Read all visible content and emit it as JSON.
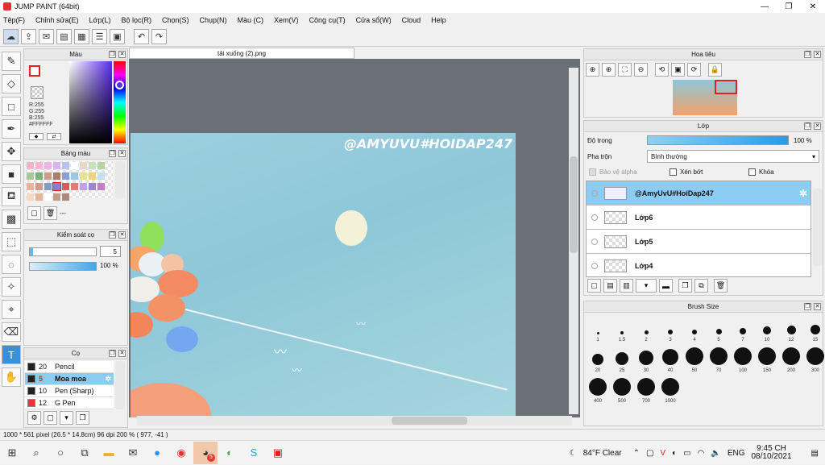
{
  "window": {
    "title": "JUMP PAINT (64bit)",
    "min": "—",
    "max": "❐",
    "close": "✕"
  },
  "menu": [
    "Tệp(F)",
    "Chỉnh sửa(E)",
    "Lớp(L)",
    "Bộ lọc(R)",
    "Chọn(S)",
    "Chụp(N)",
    "Màu (C)",
    "Xem(V)",
    "Công cụ(T)",
    "Cửa sổ(W)",
    "Cloud",
    "Help"
  ],
  "toolbar": {
    "icons": [
      "cloud-save-icon",
      "share-icon",
      "comment-icon",
      "message-icon",
      "document-icon",
      "list-icon",
      "grid-icon",
      "undo-icon",
      "redo-icon"
    ]
  },
  "tools": [
    "brush-icon",
    "eraser-icon",
    "rectangle-icon",
    "pen-icon",
    "move-icon",
    "fill-rect-icon",
    "bucket-icon",
    "gradient-icon",
    "select-rect-icon",
    "lasso-icon",
    "magic-wand-icon",
    "picker-icon",
    "select-eraser-icon",
    "text-icon",
    "hand-icon"
  ],
  "color_panel": {
    "title": "Màu",
    "r": "R:255",
    "g": "G:255",
    "b": "B:255",
    "hex": "#FFFFFF"
  },
  "palette_panel": {
    "title": "Bảng màu",
    "more": "---",
    "swatches": [
      "#f7b2c9",
      "#f6b7d6",
      "#f3b0e6",
      "#d7b3f0",
      "#b7c1f1",
      "#ffffff",
      "#e8d8c4",
      "#c6e2b7",
      "#b4d3a6",
      "#a9c99c",
      "#7ab07a",
      "#c79f86",
      "#a77f6c",
      "#8aa1d8",
      "#9bc9e2",
      "#e7e28f",
      "#f0d27e",
      "#c3e0ef",
      "#edb1a1",
      "#d39b8f",
      "#7f9ec6",
      "#8c7ed1",
      "#d35b5b",
      "#e67a7a",
      "#bfa4e3",
      "#9c83d9",
      "#c27fc7",
      "#f6d9c6",
      "#e5b59b",
      "#ffffff",
      "#c29b8a",
      "#a98a7c"
    ]
  },
  "brush_control": {
    "title": "Kiểm soát cọ",
    "size": "5",
    "opacity": "100 %"
  },
  "brushes": {
    "title": "Cọ",
    "items": [
      {
        "size": "20",
        "name": "Pencil",
        "color": "#222"
      },
      {
        "size": "5",
        "name": "Moa moa",
        "color": "#222"
      },
      {
        "size": "10",
        "name": "Pen (Sharp)",
        "color": "#222"
      },
      {
        "size": "12",
        "name": "G Pen",
        "color": "#e33"
      }
    ]
  },
  "document": {
    "tab": "tải xuống (2).png",
    "watermark": "@AMYUVU#HOIDAP247"
  },
  "navigator": {
    "title": "Hoa tiêu"
  },
  "layers": {
    "title": "Lớp",
    "opacity_label": "Độ trong",
    "opacity_value": "100 %",
    "blend_label": "Pha trộn",
    "blend_value": "Bình thường",
    "protect_alpha": "Bảo vệ alpha",
    "clip": "Xén bớt",
    "lock": "Khóa",
    "items": [
      "@AmyUvU#HoiDap247",
      "Lớp6",
      "Lớp5",
      "Lớp4"
    ]
  },
  "brush_size": {
    "title": "Brush Size",
    "sizes": [
      "1",
      "1.5",
      "2",
      "3",
      "4",
      "5",
      "7",
      "10",
      "12",
      "15",
      "20",
      "25",
      "30",
      "40",
      "50",
      "70",
      "100",
      "150",
      "200",
      "300",
      "400",
      "500",
      "700",
      "1000"
    ]
  },
  "status": {
    "text": "1000 * 561 pixel  (26.5 * 14.8cm)  96 dpi  200 %  ( 977, -41 )"
  },
  "taskbar": {
    "weather": "84°F  Clear",
    "lang": "ENG",
    "time": "9:45 CH",
    "date": "08/10/2021",
    "badge": "5"
  }
}
